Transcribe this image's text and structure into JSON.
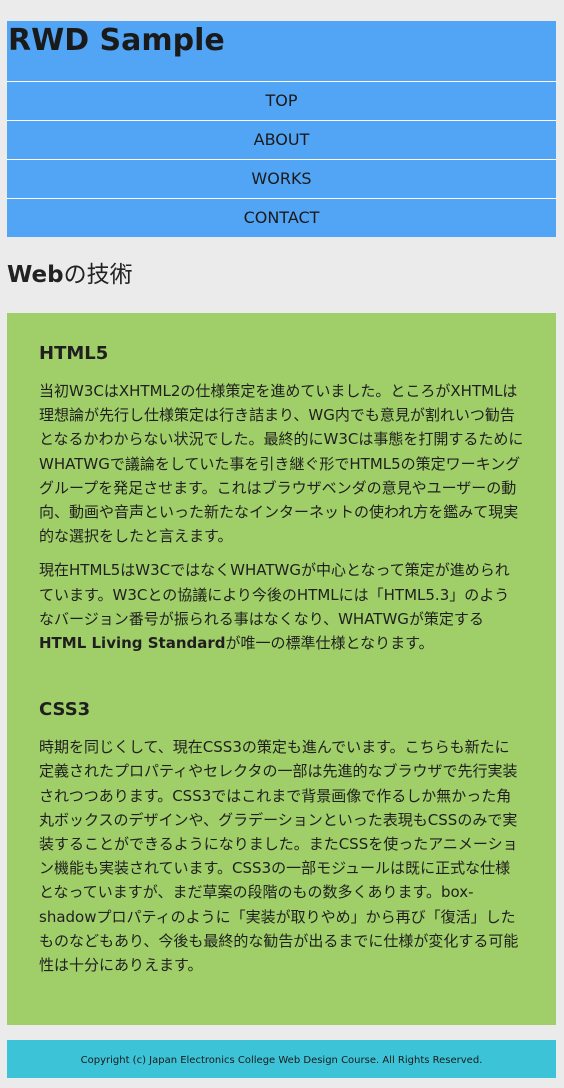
{
  "header": {
    "title": "RWD Sample"
  },
  "nav": {
    "items": [
      {
        "label": "TOP"
      },
      {
        "label": "ABOUT"
      },
      {
        "label": "WORKS"
      },
      {
        "label": "CONTACT"
      }
    ]
  },
  "main": {
    "title_bold": "Web",
    "title_rest": "の技術",
    "articles": [
      {
        "heading": "HTML5",
        "p1": "当初W3CはXHTML2の仕様策定を進めていました。ところがXHTMLは理想論が先行し仕様策定は行き詰まり、WG内でも意見が割れいつ勧告となるかわからない状況でした。最終的にW3Cは事態を打開するためにWHATWGで議論をしていた事を引き継ぐ形でHTML5の策定ワーキンググループを発足させます。これはブラウザベンダの意見やユーザーの動向、動画や音声といった新たなインターネットの使われ方を鑑みて現実的な選択をしたと言えます。",
        "p2_before": "現在HTML5はW3CではなくWHATWGが中心となって策定が進められています。W3Cとの協議により今後のHTMLには「HTML5.3」のようなバージョン番号が振られる事はなくなり、WHATWGが策定する",
        "p2_strong": "HTML Living Standard",
        "p2_after": "が唯一の標準仕様となります。"
      },
      {
        "heading": "CSS3",
        "p1": "時期を同じくして、現在CSS3の策定も進んでいます。こちらも新たに定義されたプロパティやセレクタの一部は先進的なブラウザで先行実装されつつあります。CSS3ではこれまで背景画像で作るしか無かった角丸ボックスのデザインや、グラデーションといった表現もCSSのみで実装することができるようになりました。またCSSを使ったアニメーション機能も実装されています。CSS3の一部モジュールは既に正式な仕様となっていますが、まだ草案の段階のもの数多くあります。box-shadowプロパティのように「実装が取りやめ」から再び「復活」したものなどもあり、今後も最終的な勧告が出るまでに仕様が変化する可能性は十分にありえます。"
      }
    ]
  },
  "footer": {
    "copyright": "Copyright (c) Japan Electronics College Web Design Course. All Rights Reserved."
  },
  "colors": {
    "header_bg": "#52a4f5",
    "content_bg": "#a0ce68",
    "footer_bg": "#3cc3d7",
    "page_bg": "#ebebeb"
  }
}
